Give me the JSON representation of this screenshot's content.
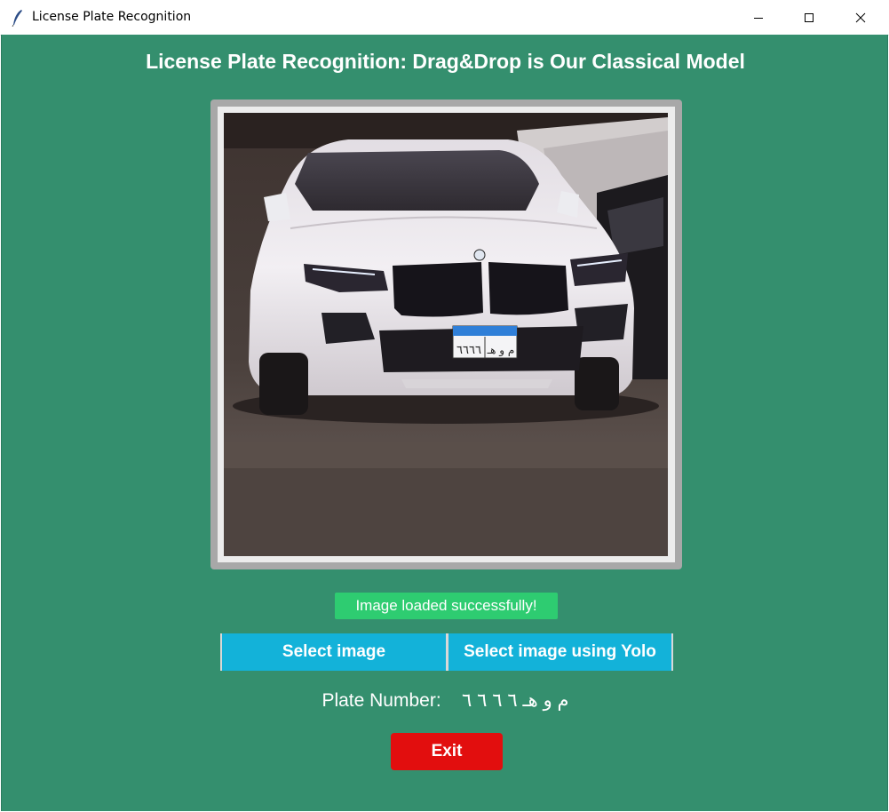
{
  "window": {
    "title": "License Plate Recognition",
    "icon": "feather-icon"
  },
  "header": {
    "title": "License Plate Recognition: Drag&Drop is Our Classical Model"
  },
  "image_panel": {
    "content": "photo of white BMW X6 with Egyptian license plate"
  },
  "status": {
    "text": "Image loaded successfully!",
    "color": "#2ecc71"
  },
  "buttons": {
    "select_label": "Select image",
    "yolo_label": "Select image using Yolo",
    "exit_label": "Exit"
  },
  "result": {
    "label": "Plate Number:",
    "value": "م و هـ ٦ ٦ ٦ ٦"
  },
  "colors": {
    "background": "#348f6e",
    "button_blue": "#13b2d9",
    "exit_red": "#e20e0e",
    "frame": "#a8a8a8"
  }
}
